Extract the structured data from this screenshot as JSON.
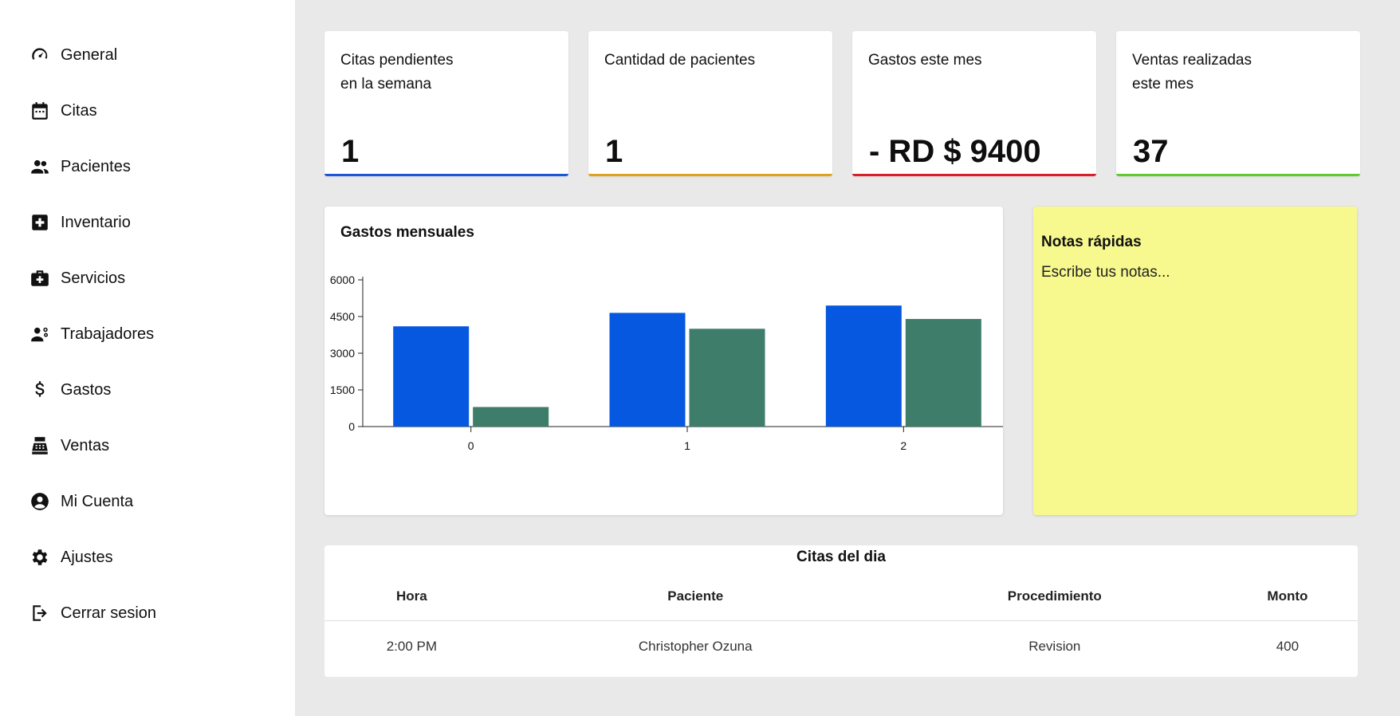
{
  "sidebar": {
    "items": [
      {
        "label": "General",
        "icon": "speedometer-icon"
      },
      {
        "label": "Citas",
        "icon": "calendar-icon"
      },
      {
        "label": "Pacientes",
        "icon": "people-icon"
      },
      {
        "label": "Inventario",
        "icon": "medical-plus-icon"
      },
      {
        "label": "Servicios",
        "icon": "medical-bag-icon"
      },
      {
        "label": "Trabajadores",
        "icon": "workers-icon"
      },
      {
        "label": "Gastos",
        "icon": "dollar-icon"
      },
      {
        "label": "Ventas",
        "icon": "cash-register-icon"
      },
      {
        "label": "Mi Cuenta",
        "icon": "account-circle-icon"
      },
      {
        "label": "Ajustes",
        "icon": "gear-icon"
      },
      {
        "label": "Cerrar sesion",
        "icon": "logout-icon"
      }
    ]
  },
  "cards": [
    {
      "title": "Citas pendientes\nen la semana",
      "value": "1",
      "accent": "#1a56d6"
    },
    {
      "title": "Cantidad de pacientes",
      "value": "1",
      "accent": "#e0a21a"
    },
    {
      "title": "Gastos este mes",
      "value": "- RD $ 9400",
      "accent": "#d6212b"
    },
    {
      "title": "Ventas realizadas\neste mes",
      "value": "37",
      "accent": "#5ecb2f"
    }
  ],
  "chart": {
    "title": "Gastos mensuales"
  },
  "chart_data": {
    "type": "bar",
    "categories": [
      "0",
      "1",
      "2"
    ],
    "series": [
      {
        "values": [
          4100,
          4650,
          4950
        ],
        "color": "#0758e1"
      },
      {
        "values": [
          800,
          4000,
          4400
        ],
        "color": "#3d7d69"
      }
    ],
    "yticks": [
      0,
      1500,
      3000,
      4500,
      6000
    ],
    "ylim": [
      0,
      6000
    ]
  },
  "notes": {
    "title": "Notas rápidas",
    "placeholder": "Escribe tus notas..."
  },
  "appointments": {
    "title": "Citas del dia",
    "columns": [
      "Hora",
      "Paciente",
      "Procedimiento",
      "Monto"
    ],
    "rows": [
      [
        "2:00 PM",
        "Christopher Ozuna",
        "Revision",
        "400"
      ]
    ]
  }
}
